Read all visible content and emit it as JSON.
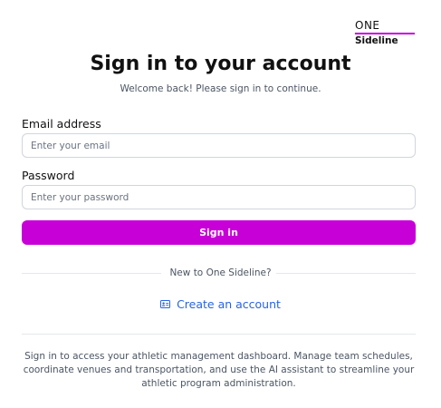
{
  "brand": {
    "line1": "ONE",
    "line2": "Sideline",
    "accent_color": "#c800d8"
  },
  "header": {
    "title": "Sign in to your account",
    "subtitle": "Welcome back! Please sign in to continue."
  },
  "form": {
    "email": {
      "label": "Email address",
      "placeholder": "Enter your email",
      "value": ""
    },
    "password": {
      "label": "Password",
      "placeholder": "Enter your password",
      "value": ""
    },
    "submit_label": "Sign in"
  },
  "signup": {
    "divider_text": "New to One Sideline?",
    "link_label": "Create an account",
    "link_icon": "id-card-icon",
    "link_color": "#2563eb"
  },
  "footer": {
    "text": "Sign in to access your athletic management dashboard. Manage team schedules, coordinate venues and transportation, and use the AI assistant to streamline your athletic program administration."
  }
}
